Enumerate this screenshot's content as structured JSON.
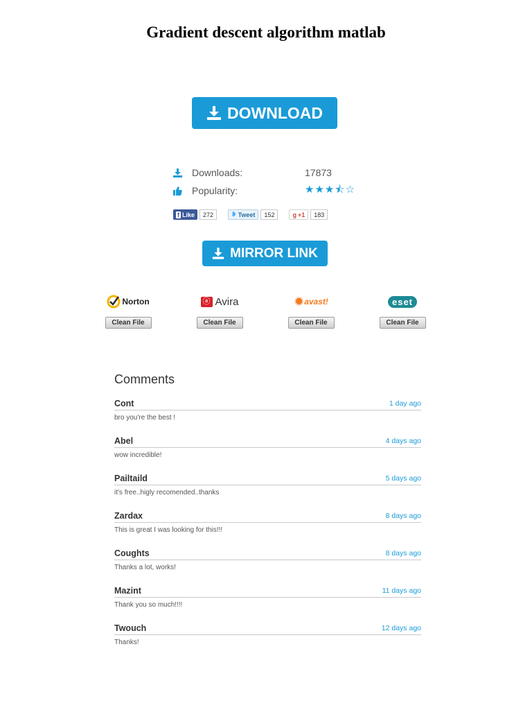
{
  "title": "Gradient descent algorithm matlab",
  "download_button": {
    "label": "DOWNLOAD"
  },
  "mirror_button": {
    "label": "MIRROR LINK"
  },
  "stats": {
    "downloads_label": "Downloads:",
    "downloads_value": "17873",
    "popularity_label": "Popularity:",
    "popularity_rating": 3.5,
    "popularity_max": 5
  },
  "social": {
    "facebook": {
      "label": "Like",
      "count": "272"
    },
    "twitter": {
      "label": "Tweet",
      "count": "152"
    },
    "google": {
      "label": "+1",
      "count": "183"
    }
  },
  "antivirus": [
    {
      "name": "Norton",
      "button": "Clean File"
    },
    {
      "name": "Avira",
      "button": "Clean File"
    },
    {
      "name": "avast!",
      "button": "Clean File"
    },
    {
      "name": "eset",
      "button": "Clean File"
    }
  ],
  "comments_title": "Comments",
  "comments": [
    {
      "name": "Cont",
      "date": "1 day ago",
      "text": "bro you're the best !"
    },
    {
      "name": "Abel",
      "date": "4 days ago",
      "text": "wow incredible!"
    },
    {
      "name": "Pailtaild",
      "date": "5 days ago",
      "text": "it's free..higly recomended..thanks"
    },
    {
      "name": "Zardax",
      "date": "8 days ago",
      "text": "This is great I was looking for this!!!"
    },
    {
      "name": "Coughts",
      "date": "8 days ago",
      "text": "Thanks a lot, works!"
    },
    {
      "name": "Mazint",
      "date": "11 days ago",
      "text": "Thank you so much!!!!"
    },
    {
      "name": "Twouch",
      "date": "12 days ago",
      "text": "Thanks!"
    }
  ],
  "colors": {
    "accent": "#1a9bd7",
    "facebook": "#3b5998"
  }
}
